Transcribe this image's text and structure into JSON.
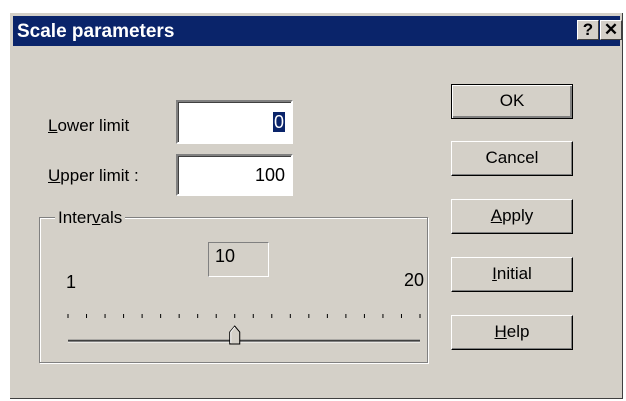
{
  "window": {
    "title": "Scale parameters",
    "help_button": "?",
    "close_button": "✕"
  },
  "fields": {
    "lower_limit": {
      "label_pre": "",
      "label_mnemonic": "L",
      "label_post": "ower limit",
      "value": "0"
    },
    "upper_limit": {
      "label_pre": "",
      "label_mnemonic": "U",
      "label_post": "pper limit :",
      "value": "100"
    }
  },
  "intervals": {
    "label_pre": "Inter",
    "label_mnemonic": "v",
    "label_post": "als",
    "current_value": "10",
    "min_label": "1",
    "max_label": "20",
    "min": 1,
    "max": 20,
    "value": 10
  },
  "buttons": {
    "ok": {
      "pre": "OK",
      "mnemonic": "",
      "post": ""
    },
    "cancel": {
      "pre": "Cancel",
      "mnemonic": "",
      "post": ""
    },
    "apply": {
      "pre": "",
      "mnemonic": "A",
      "post": "pply"
    },
    "initial": {
      "pre": "",
      "mnemonic": "I",
      "post": "nitial"
    },
    "help": {
      "pre": "",
      "mnemonic": "H",
      "post": "elp"
    }
  }
}
